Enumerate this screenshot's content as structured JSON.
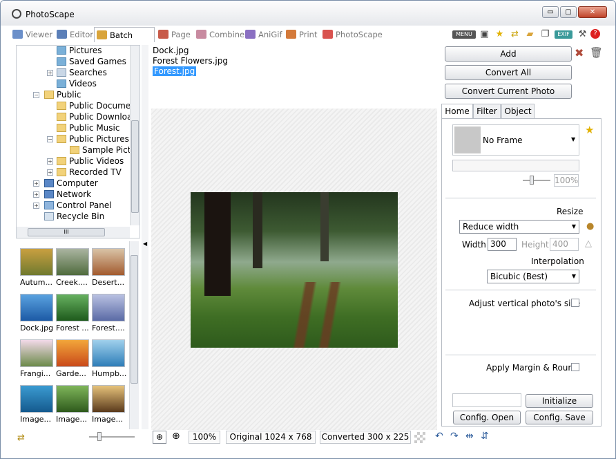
{
  "app": {
    "title": "PhotoScape"
  },
  "window_buttons": {
    "minimize": "▭",
    "maximize": "▢",
    "close": "✕"
  },
  "tabs": [
    {
      "label": "Viewer",
      "icon": "viewer-icon"
    },
    {
      "label": "Editor",
      "icon": "editor-icon"
    },
    {
      "label": "Batch Editor",
      "icon": "batch-editor-icon"
    },
    {
      "label": "Page",
      "icon": "page-icon"
    },
    {
      "label": "Combine",
      "icon": "combine-icon"
    },
    {
      "label": "AniGif",
      "icon": "anigif-icon"
    },
    {
      "label": "Print",
      "icon": "print-icon"
    },
    {
      "label": "PhotoScape",
      "icon": "photoscape-icon"
    }
  ],
  "toolbar_icons": {
    "menu": "MENU",
    "exif": "EXIF"
  },
  "tree": [
    {
      "label": "Pictures"
    },
    {
      "label": "Saved Games"
    },
    {
      "label": "Searches"
    },
    {
      "label": "Videos"
    },
    {
      "label": "Public"
    },
    {
      "label": "Public Documents"
    },
    {
      "label": "Public Downloads"
    },
    {
      "label": "Public Music"
    },
    {
      "label": "Public Pictures"
    },
    {
      "label": "Sample Pictures"
    },
    {
      "label": "Public Videos"
    },
    {
      "label": "Recorded TV"
    },
    {
      "label": "Computer"
    },
    {
      "label": "Network"
    },
    {
      "label": "Control Panel"
    },
    {
      "label": "Recycle Bin"
    }
  ],
  "tree_hscroll_grip": "III",
  "thumbnails": [
    {
      "label": "Autum..."
    },
    {
      "label": "Creek...."
    },
    {
      "label": "Desert..."
    },
    {
      "label": "Dock.jpg"
    },
    {
      "label": "Forest ..."
    },
    {
      "label": "Forest...."
    },
    {
      "label": "Frangi..."
    },
    {
      "label": "Garde..."
    },
    {
      "label": "Humpb..."
    },
    {
      "label": "Image..."
    },
    {
      "label": "Image..."
    },
    {
      "label": "Image..."
    }
  ],
  "files": [
    "Dock.jpg",
    "Forest Flowers.jpg",
    "Forest.jpg"
  ],
  "selected_file": "Forest.jpg",
  "buttons": {
    "add": "Add",
    "convert_all": "Convert All",
    "convert_current": "Convert Current Photo",
    "initialize": "Initialize",
    "config_open": "Config. Open",
    "config_save": "Config. Save"
  },
  "panel_tabs": [
    "Home",
    "Filter",
    "Object"
  ],
  "frame": {
    "value": "No Frame",
    "opacity": "100%"
  },
  "resize": {
    "title": "Resize",
    "mode": "Reduce width",
    "width_label": "Width",
    "width_value": "300",
    "height_label": "Height",
    "height_value": "400"
  },
  "interpolation": {
    "title": "Interpolation",
    "value": "Bicubic (Best)"
  },
  "options": {
    "adjust_vertical": "Adjust vertical photo's size",
    "apply_margin": "Apply Margin & Round"
  },
  "status": {
    "zoom": "100%",
    "original": "Original 1024 x 768",
    "converted": "Converted 300 x 225"
  }
}
